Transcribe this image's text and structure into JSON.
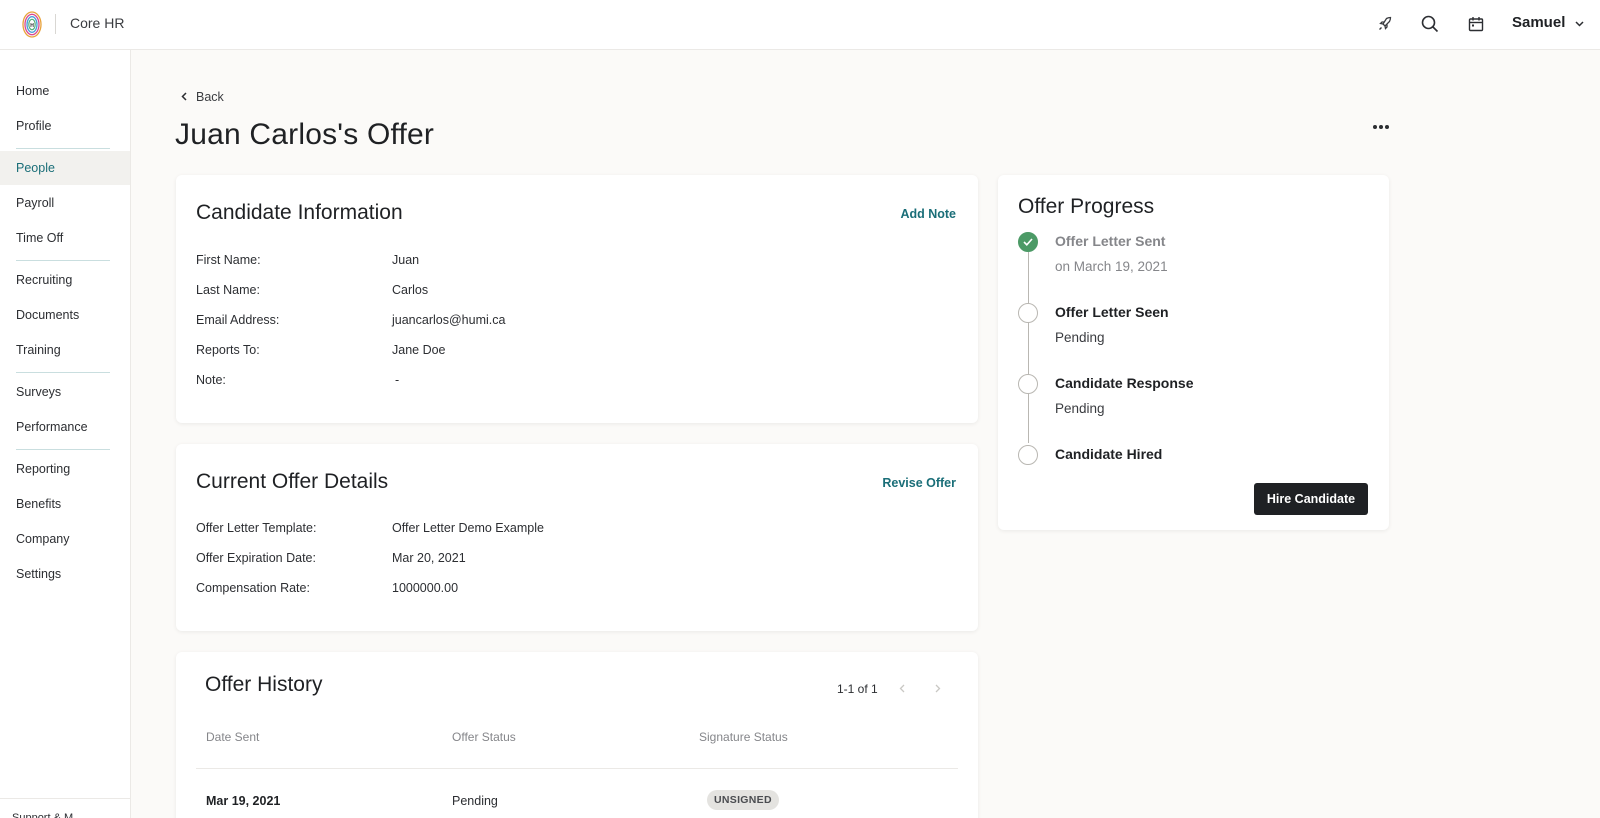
{
  "app": {
    "title": "Core HR"
  },
  "header": {
    "user_name": "Samuel"
  },
  "sidebar": {
    "items": [
      {
        "label": "Home"
      },
      {
        "label": "Profile"
      },
      {
        "label": "People"
      },
      {
        "label": "Payroll"
      },
      {
        "label": "Time Off"
      },
      {
        "label": "Recruiting"
      },
      {
        "label": "Documents"
      },
      {
        "label": "Training"
      },
      {
        "label": "Surveys"
      },
      {
        "label": "Performance"
      },
      {
        "label": "Reporting"
      },
      {
        "label": "Benefits"
      },
      {
        "label": "Company"
      },
      {
        "label": "Settings"
      }
    ],
    "active": "People",
    "footer": "Support & M..."
  },
  "page": {
    "back_label": "Back",
    "title": "Juan Carlos's Offer"
  },
  "candidate": {
    "title": "Candidate Information",
    "action": "Add Note",
    "fields": [
      {
        "label": "First Name:",
        "value": "Juan"
      },
      {
        "label": "Last Name:",
        "value": "Carlos"
      },
      {
        "label": "Email Address:",
        "value": "juancarlos@humi.ca"
      },
      {
        "label": "Reports To:",
        "value": "Jane Doe"
      },
      {
        "label": "Note:",
        "value": "-"
      }
    ]
  },
  "offer": {
    "title": "Current Offer Details",
    "action": "Revise Offer",
    "fields": [
      {
        "label": "Offer Letter Template:",
        "value": "Offer Letter Demo Example"
      },
      {
        "label": "Offer Expiration Date:",
        "value": "Mar 20, 2021"
      },
      {
        "label": "Compensation Rate:",
        "value": "1000000.00"
      }
    ]
  },
  "history": {
    "title": "Offer History",
    "pagination": "1-1 of 1",
    "columns": [
      "Date Sent",
      "Offer Status",
      "Signature Status"
    ],
    "rows": [
      {
        "date": "Mar 19, 2021",
        "status": "Pending",
        "signature": "UNSIGNED"
      }
    ]
  },
  "progress": {
    "title": "Offer Progress",
    "steps": [
      {
        "title": "Offer Letter Sent",
        "sub": "on March 19, 2021",
        "done": true
      },
      {
        "title": "Offer Letter Seen",
        "sub": "Pending",
        "done": false
      },
      {
        "title": "Candidate Response",
        "sub": "Pending",
        "done": false
      },
      {
        "title": "Candidate Hired",
        "sub": "",
        "done": false
      }
    ],
    "button": "Hire Candidate"
  },
  "colors": {
    "accent": "#1a6e78",
    "success": "#4c9a66",
    "primary_button": "#1f2124",
    "background": "#fbfaf8"
  },
  "icons": [
    "logo-icon",
    "rocket-icon",
    "search-icon",
    "calendar-icon",
    "chevron-down-icon",
    "chevron-left-icon",
    "more-icon",
    "check-icon"
  ]
}
